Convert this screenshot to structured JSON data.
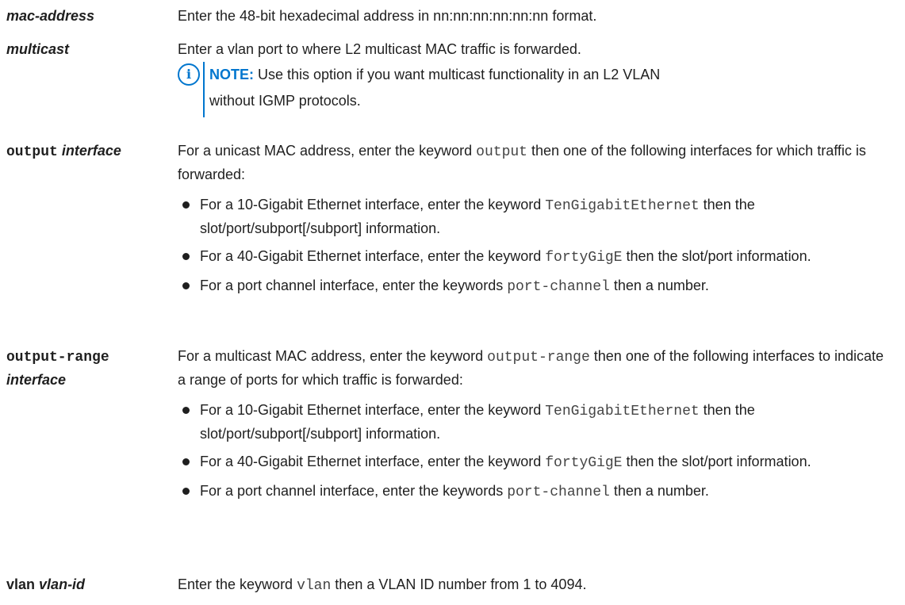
{
  "rows": {
    "mac_address": {
      "term": "mac-address",
      "desc": "Enter the 48-bit hexadecimal address in nn:nn:nn:nn:nn:nn format."
    },
    "multicast": {
      "term": "multicast",
      "desc": "Enter a vlan port to where L2 multicast MAC traffic is forwarded.",
      "note_label": "NOTE:",
      "note_line1": " Use this option if you want multicast functionality in an L2 VLAN",
      "note_line2": "without IGMP protocols."
    },
    "output": {
      "term_kw": "output",
      "term_arg": "interface",
      "desc_a": "For a unicast MAC address, enter the keyword ",
      "desc_code": "output",
      "desc_b": " then one of the following interfaces for which traffic is forwarded:",
      "bullets": [
        {
          "a": "For a 10-Gigabit Ethernet interface, enter the keyword ",
          "code": "TenGigabitEthernet",
          "b": " then the slot/port/subport[/subport] information."
        },
        {
          "a": "For a 40-Gigabit Ethernet interface, enter the keyword ",
          "code": "fortyGigE",
          "b": " then the slot/port information."
        },
        {
          "a": "For a port channel interface, enter the keywords ",
          "code": "port-channel",
          "b": " then a number."
        }
      ]
    },
    "output_range": {
      "term_kw": "output-range",
      "term_arg": "interface",
      "desc_a": "For a multicast MAC address, enter the keyword ",
      "desc_code": "output-range",
      "desc_b": " then one of the following interfaces to indicate a range of ports for which traffic is forwarded:",
      "bullets": [
        {
          "a": "For a 10-Gigabit Ethernet interface, enter the keyword ",
          "code": "TenGigabitEthernet",
          "b": " then the slot/port/subport[/subport] information."
        },
        {
          "a": "For a 40-Gigabit Ethernet interface, enter the keyword ",
          "code": "fortyGigE",
          "b": " then the slot/port information."
        },
        {
          "a": "For a port channel interface, enter the keywords ",
          "code": "port-channel",
          "b": " then a number."
        }
      ]
    },
    "vlan": {
      "term_kw": "vlan",
      "term_arg": "vlan-id",
      "desc_a": "Enter the keyword ",
      "desc_code": "vlan",
      "desc_b": " then a VLAN ID number from 1 to 4094."
    }
  },
  "icons": {
    "note": "info-circle-icon",
    "bullet": "bullet-dot-icon"
  },
  "colors": {
    "note_accent": "#0076ce",
    "text": "#1f1f1f"
  }
}
